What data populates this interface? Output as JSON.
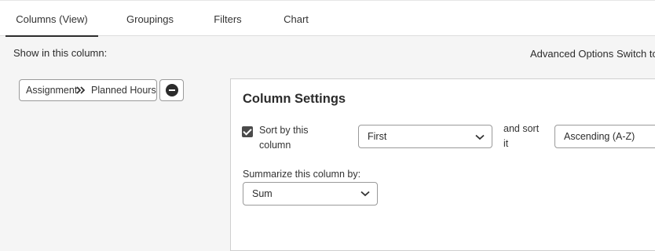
{
  "tabs": [
    {
      "label": "Columns (View)",
      "active": true
    },
    {
      "label": "Groupings",
      "active": false
    },
    {
      "label": "Filters",
      "active": false
    },
    {
      "label": "Chart",
      "active": false
    }
  ],
  "show_label": "Show in this column:",
  "toolbar_links": {
    "advanced_options": "Advanced Options",
    "switch_to": "Switch to"
  },
  "field_chip": {
    "object": "Assignment",
    "separator_icon": "double-chevron-right-icon",
    "field": "Planned Hours"
  },
  "remove_icon": "minus-circle-icon",
  "settings": {
    "title": "Column Settings",
    "sort_checkbox_checked": true,
    "sort_label_line1": "Sort by this",
    "sort_label_line2": "column",
    "sort_order_value": "First",
    "and_sort_line1": "and sort",
    "and_sort_line2": "it",
    "sort_direction_value": "Ascending (A-Z)",
    "summarize_label": "Summarize this column by:",
    "summarize_value": "Sum"
  },
  "colors": {
    "accent_dark": "#2c2c2c",
    "background": "#f5f5f5",
    "panel": "#ffffff"
  }
}
